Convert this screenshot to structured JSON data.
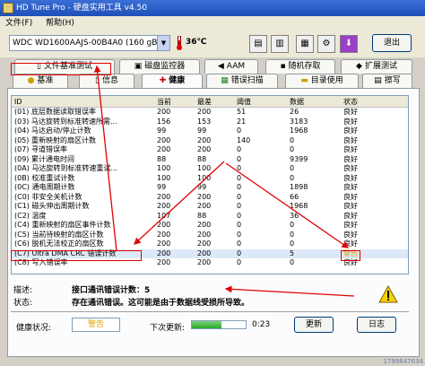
{
  "window": {
    "title": "HD Tune Pro - 硬盘实用工具 v4.50"
  },
  "menu": {
    "file": "文件(F)",
    "help": "帮助(H)"
  },
  "toolbar": {
    "drive": "WDC WD1600AAJS-00B4A0 (160 gB)",
    "temperature": "36℃",
    "exit_label": "退出"
  },
  "tabs_row1": [
    {
      "label": "文件基准测试",
      "icon": "file-icon"
    },
    {
      "label": "磁盘监控器",
      "icon": "monitor-icon"
    },
    {
      "label": "AAM",
      "icon": "speaker-icon"
    },
    {
      "label": "随机存取",
      "icon": "random-access-icon"
    },
    {
      "label": "扩展测试",
      "icon": "extended-test-icon"
    }
  ],
  "tabs_row2": [
    {
      "label": "基准",
      "icon": "bulb-icon"
    },
    {
      "label": "信息",
      "icon": "info-icon"
    },
    {
      "label": "健康",
      "icon": "health-cross-icon"
    },
    {
      "label": "错误扫描",
      "icon": "error-scan-icon"
    },
    {
      "label": "目录使用",
      "icon": "folder-icon"
    },
    {
      "label": "擦写",
      "icon": "erase-icon"
    }
  ],
  "table": {
    "headers": [
      "ID",
      "当前",
      "最差",
      "阈值",
      "数据",
      "状态"
    ],
    "rows": [
      [
        "(01) 底层数据读取错误率",
        "200",
        "200",
        "51",
        "26",
        "良好"
      ],
      [
        "(03) 马达旋转到标准转速所需...",
        "156",
        "153",
        "21",
        "3183",
        "良好"
      ],
      [
        "(04) 马达启动/停止计数",
        "99",
        "99",
        "0",
        "1968",
        "良好"
      ],
      [
        "(05) 重新映射的扇区计数",
        "200",
        "200",
        "140",
        "0",
        "良好"
      ],
      [
        "(07) 寻道错误率",
        "200",
        "200",
        "0",
        "0",
        "良好"
      ],
      [
        "(09) 累计通电时间",
        "88",
        "88",
        "0",
        "9399",
        "良好"
      ],
      [
        "(0A) 马达旋转到标准转速重试...",
        "100",
        "100",
        "0",
        "0",
        "良好"
      ],
      [
        "(0B) 校准重试计数",
        "100",
        "100",
        "0",
        "0",
        "良好"
      ],
      [
        "(0C) 通电周期计数",
        "99",
        "99",
        "0",
        "1898",
        "良好"
      ],
      [
        "(C0) 非安全关机计数",
        "200",
        "200",
        "0",
        "66",
        "良好"
      ],
      [
        "(C1) 磁头伸出周期计数",
        "200",
        "200",
        "0",
        "1968",
        "良好"
      ],
      [
        "(C2) 温度",
        "107",
        "88",
        "0",
        "36",
        "良好"
      ],
      [
        "(C4) 重新映射的扇区事件计数",
        "200",
        "200",
        "0",
        "0",
        "良好"
      ],
      [
        "(C5) 当前待映射的扇区计数",
        "200",
        "200",
        "0",
        "0",
        "良好"
      ],
      [
        "(C6) 脱机无法校正的扇区数",
        "200",
        "200",
        "0",
        "0",
        "良好"
      ],
      [
        "(C7) Ultra DMA CRC 错误计数",
        "200",
        "200",
        "0",
        "5",
        "警告"
      ],
      [
        "(C8) 写入错误率",
        "200",
        "200",
        "0",
        "0",
        "良好"
      ]
    ]
  },
  "detail": {
    "desc_label": "描述:",
    "desc_value": "接口通讯错误计数：5",
    "state_label": "状态:",
    "state_value": "存在通讯错误。这可能是由于数据线受损所导致。"
  },
  "footer": {
    "health_label": "健康状况:",
    "health_value": "警告",
    "next_update_label": "下次更新:",
    "progress": 0.55,
    "countdown": "0:23",
    "refresh_label": "更新",
    "log_label": "日志",
    "corner_text": "1799847634"
  },
  "colors": {
    "warning": "#e0a000",
    "annotation": "#e00000",
    "selection": "#dde9f8"
  }
}
